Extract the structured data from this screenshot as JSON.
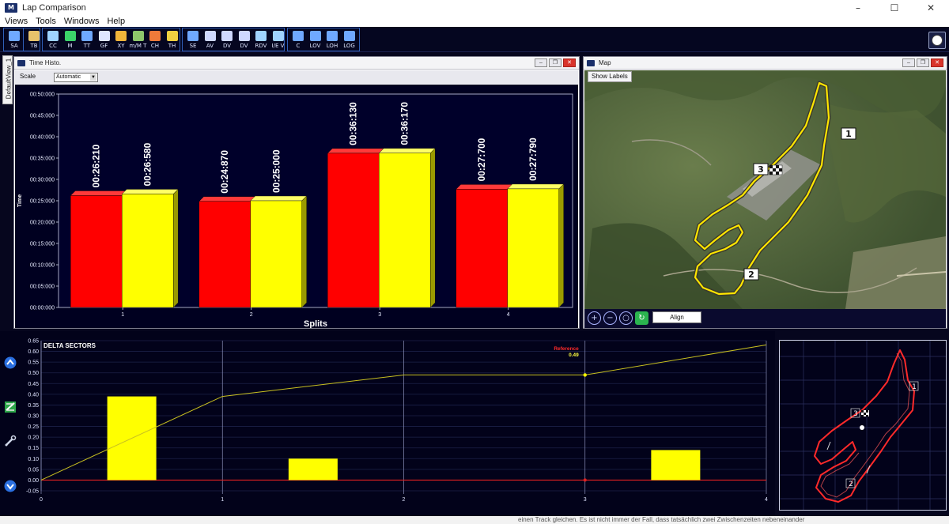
{
  "window": {
    "title": "Lap Comparison",
    "controls": {
      "minimize": "–",
      "maximize": "☐",
      "close": "✕"
    }
  },
  "menu": [
    "Views",
    "Tools",
    "Windows",
    "Help"
  ],
  "toolbar": {
    "groups": [
      {
        "buttons": [
          {
            "label": "SA",
            "icon": "sa-icon",
            "color": "#6fa8ff"
          }
        ]
      },
      {
        "buttons": [
          {
            "label": "TB",
            "icon": "hourglass-icon",
            "color": "#e8c36b"
          }
        ]
      },
      {
        "buttons": [
          {
            "label": "CC",
            "icon": "wave-icon",
            "color": "#9fd3ff"
          },
          {
            "label": "M",
            "icon": "track-icon",
            "color": "#3bd36a"
          },
          {
            "label": "TT",
            "icon": "calendar-icon",
            "color": "#6fa8ff"
          },
          {
            "label": "GF",
            "icon": "target-icon",
            "color": "#dfe6ff"
          },
          {
            "label": "XY",
            "icon": "scatter-icon",
            "color": "#f0b43a"
          },
          {
            "label": "m/M T",
            "icon": "minmax-icon",
            "color": "#8ec66b"
          },
          {
            "label": "CH",
            "icon": "bars-icon",
            "color": "#f07a3a"
          },
          {
            "label": "TH",
            "icon": "histogram-icon",
            "color": "#f0d040"
          }
        ]
      },
      {
        "buttons": [
          {
            "label": "SE",
            "icon": "save-icon",
            "color": "#6fa8ff"
          },
          {
            "label": "AV",
            "icon": "monitor-icon",
            "color": "#cfd8ff"
          },
          {
            "label": "DV",
            "icon": "monitor-icon",
            "color": "#cfd8ff"
          },
          {
            "label": "DV",
            "icon": "stack-icon",
            "color": "#cfd8ff"
          },
          {
            "label": "RDV",
            "icon": "refresh-icon",
            "color": "#9fd3ff"
          },
          {
            "label": "I/E V",
            "icon": "import-icon",
            "color": "#9fd3ff"
          }
        ]
      },
      {
        "buttons": [
          {
            "label": "C",
            "icon": "windows-icon",
            "color": "#6fa8ff"
          },
          {
            "label": "LOV",
            "icon": "rows-icon",
            "color": "#6fa8ff"
          },
          {
            "label": "LOH",
            "icon": "columns-icon",
            "color": "#6fa8ff"
          },
          {
            "label": "LOG",
            "icon": "grid-icon",
            "color": "#6fa8ff"
          }
        ]
      }
    ]
  },
  "side_tab": {
    "label": "DefaultView_1"
  },
  "histo": {
    "title": "Time Histo.",
    "scale_label": "Scale",
    "scale_value": "Automatic",
    "chart_data": {
      "type": "bar",
      "categories": [
        "1",
        "2",
        "3",
        "4"
      ],
      "series": [
        {
          "color": "#ff0000",
          "values": [
            26.21,
            24.87,
            36.13,
            27.7
          ],
          "labels": [
            "00:26:210",
            "00:24:870",
            "00:36:130",
            "00:27:700"
          ]
        },
        {
          "color": "#ffff00",
          "values": [
            26.58,
            25.0,
            36.17,
            27.79
          ],
          "labels": [
            "00:26:580",
            "00:25:000",
            "00:36:170",
            "00:27:790"
          ]
        }
      ],
      "xlabel": "Splits",
      "ylabel": "Time",
      "ylim": [
        0,
        50
      ],
      "yticks": [
        {
          "v": 0,
          "label": "00:00:000"
        },
        {
          "v": 5,
          "label": "00:05:000"
        },
        {
          "v": 10,
          "label": "00:10:000"
        },
        {
          "v": 15,
          "label": "00:15:000"
        },
        {
          "v": 20,
          "label": "00:20:000"
        },
        {
          "v": 25,
          "label": "00:25:000"
        },
        {
          "v": 30,
          "label": "00:30:000"
        },
        {
          "v": 35,
          "label": "00:35:000"
        },
        {
          "v": 40,
          "label": "00:40:000"
        },
        {
          "v": 45,
          "label": "00:45:000"
        },
        {
          "v": 50,
          "label": "00:50:000"
        }
      ]
    }
  },
  "map": {
    "title": "Map",
    "show_labels": "Show Labels",
    "align": "Align",
    "markers": [
      "1",
      "2",
      "3"
    ],
    "colors": {
      "track": "#ffe600"
    }
  },
  "delta": {
    "chart_data": {
      "type": "bar",
      "title": "DELTA SECTORS",
      "xlim": [
        0,
        4
      ],
      "ylim": [
        -0.05,
        0.65
      ],
      "xticks": [
        "0",
        "1",
        "2",
        "3",
        "4"
      ],
      "yticks": [
        "-0.05",
        "0.00",
        "0.05",
        "0.10",
        "0.15",
        "0.20",
        "0.25",
        "0.30",
        "0.35",
        "0.40",
        "0.45",
        "0.50",
        "0.55",
        "0.60",
        "0.65"
      ],
      "bars": [
        {
          "x": 0.5,
          "value": 0.39
        },
        {
          "x": 1.5,
          "value": 0.1
        },
        {
          "x": 3.5,
          "value": 0.14
        }
      ],
      "cumulative": [
        {
          "x": 0,
          "y": 0.0
        },
        {
          "x": 1,
          "y": 0.39
        },
        {
          "x": 2,
          "y": 0.49
        },
        {
          "x": 3,
          "y": 0.49
        },
        {
          "x": 4,
          "y": 0.63
        }
      ],
      "reference": {
        "label": "Reference",
        "value": "0.49",
        "x": 3
      },
      "colors": {
        "bar": "#ffff00",
        "line": "#c8c020",
        "zero": "#e02020"
      }
    }
  },
  "mini_map": {
    "markers": [
      "1",
      "2",
      "3"
    ],
    "colors": {
      "track": "#ff2a2a"
    }
  },
  "background_text": "einen Track gleichen. Es ist nicht immer der Fall, dass tatsächlich zwei Zwischenzeiten nebeneinander"
}
